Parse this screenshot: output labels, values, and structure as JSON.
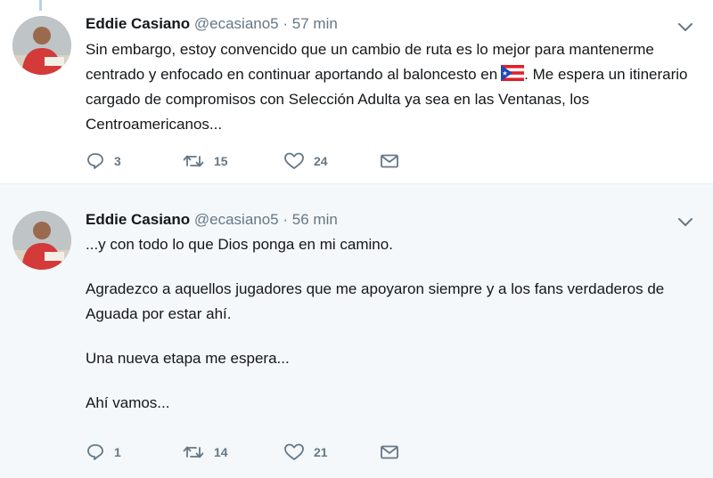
{
  "colors": {
    "secondary_text": "#657786",
    "border": "#e6ecf0",
    "alt_background": "#f5f8fa"
  },
  "tweets": [
    {
      "name": "Eddie Casiano",
      "handle": "@ecasiano5",
      "separator": "·",
      "time": "57 min",
      "text_before_flag": "Sin embargo, estoy convencido que un cambio de ruta es lo mejor para mantenerme centrado y enfocado en continuar aportando al baloncesto en",
      "flag_icon": "puerto-rico-flag-emoji",
      "text_after_flag": ". Me espera un itinerario cargado de compromisos con Selección Adulta ya sea en las Ventanas, los Centroamericanos...",
      "replies": "3",
      "retweets": "15",
      "likes": "24"
    },
    {
      "name": "Eddie Casiano",
      "handle": "@ecasiano5",
      "separator": "·",
      "time": "56 min",
      "paragraphs": [
        "...y con todo lo que Dios ponga en mi camino.",
        "Agradezco a aquellos jugadores que me apoyaron siempre y a los fans verdaderos de Aguada por estar ahí.",
        "Una nueva etapa me espera...",
        "Ahí vamos..."
      ],
      "replies": "1",
      "retweets": "14",
      "likes": "21"
    }
  ]
}
